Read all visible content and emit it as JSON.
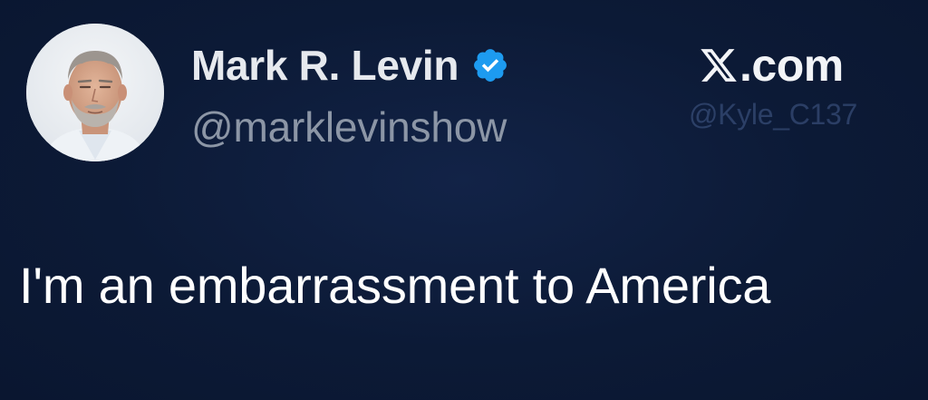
{
  "colors": {
    "background": "#0c1a36",
    "name": "#e6e9ee",
    "handle": "#8c96a6",
    "verified": "#1d9bf0",
    "text": "#ffffff"
  },
  "author": {
    "display_name": "Mark R. Levin",
    "handle": "@marklevinshow",
    "avatar_icon": "profile-photo",
    "verified_icon": "verified-badge-icon"
  },
  "brand": {
    "logo_icon": "x-logo-icon",
    "text": ".com"
  },
  "watermark": {
    "text": "@Kyle_C137"
  },
  "tweet": {
    "text": "I'm an embarrassment to America"
  }
}
